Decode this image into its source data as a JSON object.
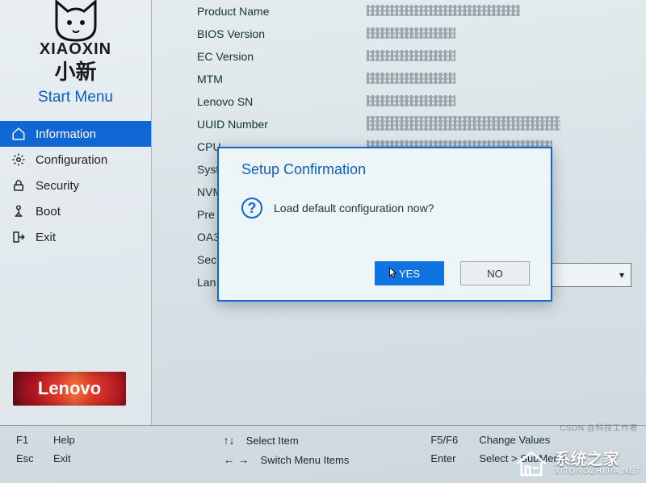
{
  "brand": {
    "english": "XIAOXIN",
    "chinese": "小新",
    "start_menu": "Start Menu",
    "lenovo": "Lenovo"
  },
  "sidebar": {
    "items": [
      {
        "label": "Information",
        "icon": "home-icon",
        "active": true
      },
      {
        "label": "Configuration",
        "icon": "gear-icon"
      },
      {
        "label": "Security",
        "icon": "lock-icon"
      },
      {
        "label": "Boot",
        "icon": "boot-icon"
      },
      {
        "label": "Exit",
        "icon": "exit-icon"
      }
    ]
  },
  "info": {
    "rows": [
      {
        "label": "Product Name"
      },
      {
        "label": "BIOS Version"
      },
      {
        "label": "EC Version"
      },
      {
        "label": "MTM"
      },
      {
        "label": "Lenovo SN"
      },
      {
        "label": "UUID Number"
      },
      {
        "label": "CPU"
      },
      {
        "label": "Syst"
      },
      {
        "label": "NVM"
      },
      {
        "label": "Pre"
      },
      {
        "label": "OA3"
      },
      {
        "label": "Sec"
      },
      {
        "label": "Lan"
      }
    ]
  },
  "dialog": {
    "title": "Setup Confirmation",
    "message": "Load default configuration now?",
    "yes": "YES",
    "no": "NO"
  },
  "footer": {
    "f1": "F1",
    "help": "Help",
    "esc": "Esc",
    "exit": "Exit",
    "select_item": "Select Item",
    "switch_menu": "Switch Menu Items",
    "f5f6": "F5/F6",
    "change_values": "Change Values",
    "enter": "Enter",
    "select_submenu": "Select > SubMenu"
  },
  "watermark": {
    "cn": "系统之家",
    "url": "XITONGZHIJIA.NET"
  },
  "csdn": "CSDN @科技工作者"
}
